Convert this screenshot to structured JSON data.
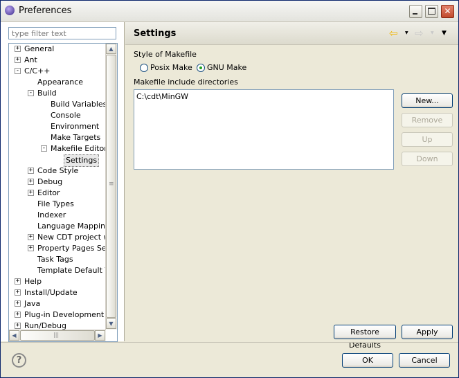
{
  "window": {
    "title": "Preferences"
  },
  "filter": {
    "placeholder": "type filter text"
  },
  "tree": [
    {
      "label": "General",
      "indent": 0,
      "expander": "+"
    },
    {
      "label": "Ant",
      "indent": 0,
      "expander": "+"
    },
    {
      "label": "C/C++",
      "indent": 0,
      "expander": "-"
    },
    {
      "label": "Appearance",
      "indent": 1,
      "expander": ""
    },
    {
      "label": "Build",
      "indent": 1,
      "expander": "-"
    },
    {
      "label": "Build Variables",
      "indent": 2,
      "expander": ""
    },
    {
      "label": "Console",
      "indent": 2,
      "expander": ""
    },
    {
      "label": "Environment",
      "indent": 2,
      "expander": ""
    },
    {
      "label": "Make Targets",
      "indent": 2,
      "expander": ""
    },
    {
      "label": "Makefile Editor",
      "indent": 2,
      "expander": "-"
    },
    {
      "label": "Settings",
      "indent": 3,
      "expander": "",
      "selected": true
    },
    {
      "label": "Code Style",
      "indent": 1,
      "expander": "+"
    },
    {
      "label": "Debug",
      "indent": 1,
      "expander": "+"
    },
    {
      "label": "Editor",
      "indent": 1,
      "expander": "+"
    },
    {
      "label": "File Types",
      "indent": 1,
      "expander": ""
    },
    {
      "label": "Indexer",
      "indent": 1,
      "expander": ""
    },
    {
      "label": "Language Mappings",
      "indent": 1,
      "expander": ""
    },
    {
      "label": "New CDT project wiz",
      "indent": 1,
      "expander": "+"
    },
    {
      "label": "Property Pages Setti",
      "indent": 1,
      "expander": "+"
    },
    {
      "label": "Task Tags",
      "indent": 1,
      "expander": ""
    },
    {
      "label": "Template Default Val",
      "indent": 1,
      "expander": ""
    },
    {
      "label": "Help",
      "indent": 0,
      "expander": "+"
    },
    {
      "label": "Install/Update",
      "indent": 0,
      "expander": "+"
    },
    {
      "label": "Java",
      "indent": 0,
      "expander": "+"
    },
    {
      "label": "Plug-in Development",
      "indent": 0,
      "expander": "+"
    },
    {
      "label": "Run/Debug",
      "indent": 0,
      "expander": "+"
    }
  ],
  "page": {
    "title": "Settings",
    "style_label": "Style of Makefile",
    "radio_posix": "Posix Make",
    "radio_gnu": "GNU Make",
    "selected_style": "GNU Make",
    "include_label": "Makefile include directories",
    "include_dirs": [
      "C:\\cdt\\MinGW"
    ]
  },
  "buttons": {
    "new": "New...",
    "remove": "Remove",
    "up": "Up",
    "down": "Down",
    "restore": "Restore Defaults",
    "apply": "Apply",
    "ok": "OK",
    "cancel": "Cancel"
  },
  "icons": {
    "help": "?",
    "back": "⇦",
    "forward": "⇨",
    "dropdown": "▼",
    "minimize": "_",
    "maximize": "□",
    "close": "✕",
    "up_arrow": "▲",
    "down_arrow": "▼",
    "left_arrow": "◀",
    "right_arrow": "▶",
    "grip": "≡",
    "grip_h": "|||"
  },
  "colors": {
    "back_arrow": "#f0b400",
    "forward_arrow": "#c8c8c8"
  }
}
